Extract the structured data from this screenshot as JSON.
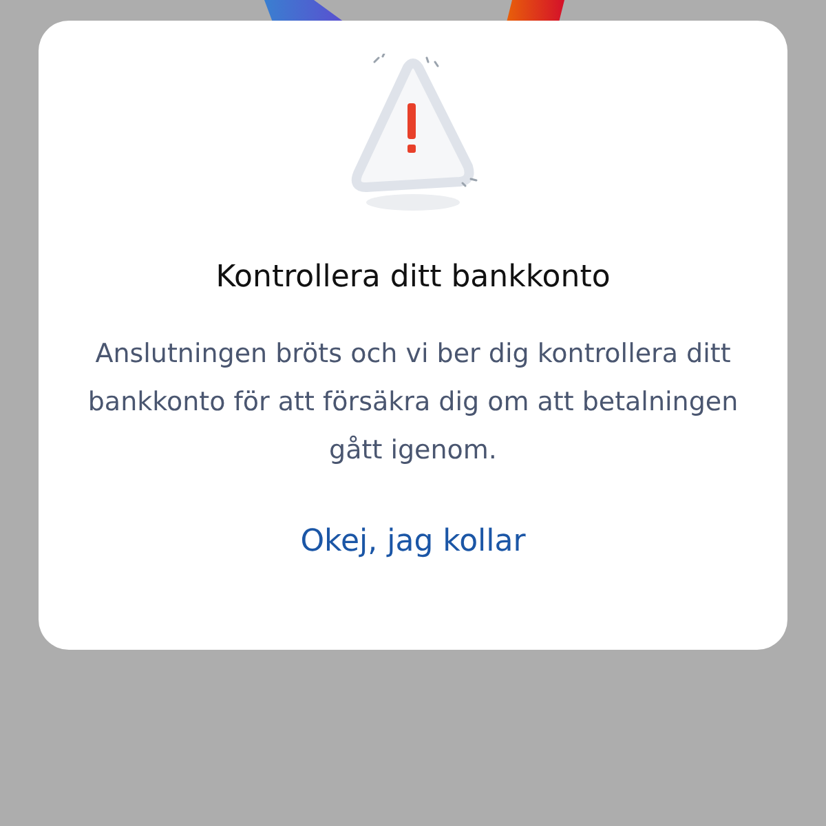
{
  "dialog": {
    "title": "Kontrollera ditt bankkonto",
    "message": "Anslutningen bröts och vi ber dig kontrollera ditt bankkonto för att försäkra dig om att betalningen gått igenom.",
    "action": "Okej, jag kollar"
  }
}
